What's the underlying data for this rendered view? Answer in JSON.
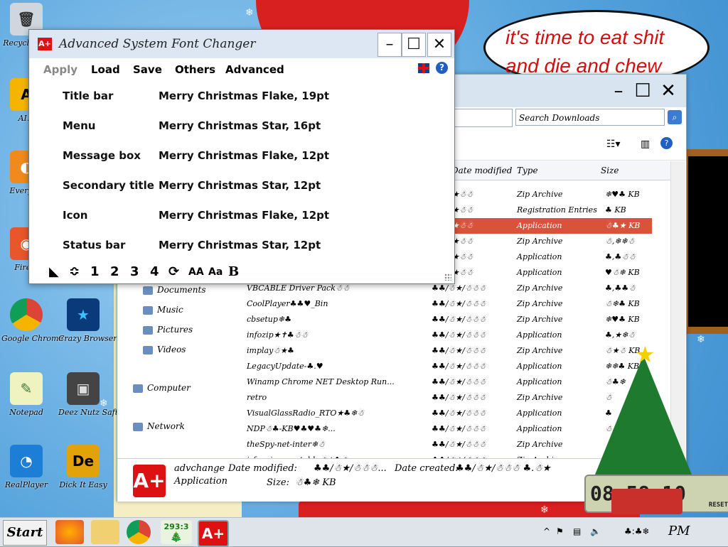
{
  "bubble": {
    "line1": "it's time to eat shit",
    "line2": "and die and chew"
  },
  "desktop_icons": [
    {
      "label": "Recycle Bin"
    },
    {
      "label": "AI..."
    },
    {
      "label": "Everyt..."
    },
    {
      "label": "Fire..."
    },
    {
      "label": "Google Chrome"
    },
    {
      "label": "Crazy Browser"
    },
    {
      "label": "Notepad"
    },
    {
      "label": "Deez Nutz Saft"
    },
    {
      "label": "RealPlayer"
    },
    {
      "label": "Dick It Easy"
    }
  ],
  "app": {
    "title": "Advanced System Font Changer",
    "logo": "A+",
    "menu": {
      "apply": "Apply",
      "load": "Load",
      "save": "Save",
      "others": "Others",
      "advanced": "Advanced",
      "help": "?"
    },
    "fonts": [
      {
        "key": "Title bar",
        "value": "Merry Christmas Flake, 19pt"
      },
      {
        "key": "Menu",
        "value": "Merry Christmas Star, 16pt"
      },
      {
        "key": "Message box",
        "value": "Merry Christmas Flake, 12pt"
      },
      {
        "key": "Secondary title",
        "value": "Merry Christmas Star, 12pt"
      },
      {
        "key": "Icon",
        "value": "Merry Christmas Flake, 12pt"
      },
      {
        "key": "Status bar",
        "value": "Merry Christmas Star, 12pt"
      }
    ],
    "tools": {
      "t1": "◣",
      "t2": "≎",
      "n1": "1",
      "n2": "2",
      "n3": "3",
      "n4": "4",
      "refresh": "⟳",
      "aa1": "AA",
      "aa2": "Aa",
      "bold": "B"
    }
  },
  "explorer": {
    "search_placeholder": "Search Downloads",
    "columns": {
      "modified": "Date modified",
      "type": "Type",
      "size": "Size"
    },
    "nav": [
      {
        "label": "Documents"
      },
      {
        "label": "Music"
      },
      {
        "label": "Pictures"
      },
      {
        "label": "Videos"
      },
      {
        "label": "Computer"
      },
      {
        "label": "Network"
      }
    ],
    "rows": [
      {
        "name": "",
        "date": "♣★✝★☃☃",
        "type": "Zip Archive",
        "size": "❄♥♣ KB"
      },
      {
        "name": "",
        "date": "♣★✝★☃☃",
        "type": "Registration Entries",
        "size": "♣ KB"
      },
      {
        "name": "",
        "date": "♣★✝★☃☃",
        "type": "Application",
        "size": "☃♣★ KB"
      },
      {
        "name": "",
        "date": "♣★✝★☃☃",
        "type": "Zip Archive",
        "size": "☃,❄❄☃"
      },
      {
        "name": "",
        "date": "♣★✝★☃☃",
        "type": "Application",
        "size": "♣,♣☃☃"
      },
      {
        "name": "",
        "date": "♣★✝★☃☃",
        "type": "Application",
        "size": "♥☃❄ KB"
      },
      {
        "name": "VBCABLE Driver Pack☃☃",
        "date": "♣♣/☃★/☃☃☃",
        "type": "Zip Archive",
        "size": "♣,♣♣☃"
      },
      {
        "name": "CoolPlayer♣♣♥_Bin",
        "date": "♣♣/☃★/☃☃☃",
        "type": "Zip Archive",
        "size": "☃❄♣ KB"
      },
      {
        "name": "cbsetup❄♣",
        "date": "♣♣/☃★/☃☃☃",
        "type": "Zip Archive",
        "size": "❄♥♣ KB"
      },
      {
        "name": "infozip★✝♣☃☃",
        "date": "♣♣/☃★/☃☃☃",
        "type": "Application",
        "size": "♣,★❄☃"
      },
      {
        "name": "implay☃★♣",
        "date": "♣♣/☃★/☃☃☃",
        "type": "Zip Archive",
        "size": "☃★☃ KB"
      },
      {
        "name": "LegacyUpdate-♣.♥",
        "date": "♣♣/☃★/☃☃☃",
        "type": "Application",
        "size": "❄❄♣ KB"
      },
      {
        "name": "Winamp Chrome NET Desktop Run...",
        "date": "♣♣/☃★/☃☃☃",
        "type": "Application",
        "size": "☃♣❄"
      },
      {
        "name": "retro",
        "date": "♣♣/☃★/☃☃☃",
        "type": "Zip Archive",
        "size": "☃"
      },
      {
        "name": "VisualGlassRadio_RTO★♣❄☃",
        "date": "♣♣/☃★/☃☃☃",
        "type": "Application",
        "size": "♣"
      },
      {
        "name": "NDP☃♣-KB♥♣♥♣❄...",
        "date": "♣♣/☃★/☃☃☃",
        "type": "Application",
        "size": "☃"
      },
      {
        "name": "theSpy-net-inter❄☃",
        "date": "♣♣/☃★/☃☃☃",
        "type": "Zip Archive",
        "size": ""
      },
      {
        "name": "irfanview portable☃★♣☃",
        "date": "♣♣/☃★/☃☃☃",
        "type": "Zip Archive",
        "size": ""
      }
    ],
    "details": {
      "name": "advchange",
      "type": "Application",
      "modified_label": "Date modified:",
      "modified_value": "♣♣/☃★/☃☃☃...",
      "created_label": "Date created:",
      "created_value": "♣♣/☃★/☃☃☃ ♣.☃★",
      "size_label": "Size:",
      "size_value": "☃♣❄ KB"
    }
  },
  "taskbar": {
    "start": "Start",
    "counter": "293:3",
    "clock": "PM",
    "tray_time": "♣:♣❄"
  },
  "counter_widget": {
    "display": "08:58:10",
    "reset": "RESET"
  }
}
